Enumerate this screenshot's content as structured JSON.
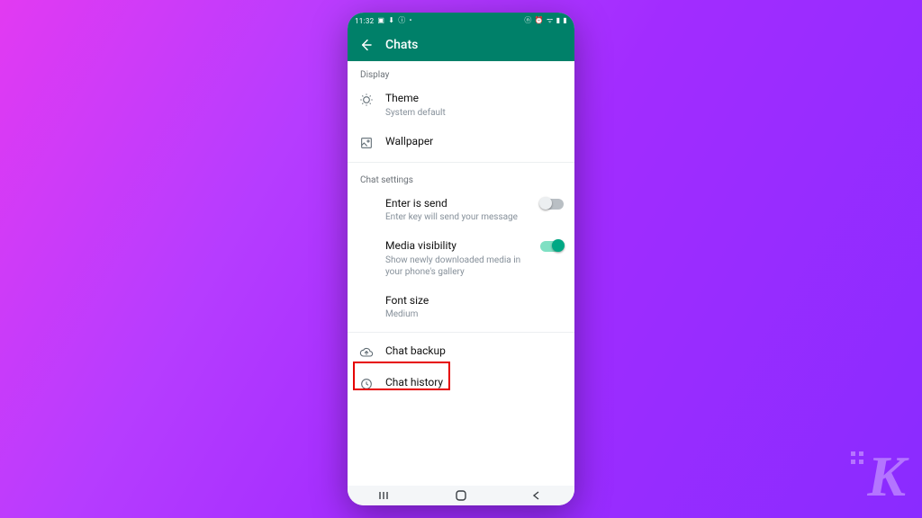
{
  "statusbar": {
    "time": "11:32"
  },
  "appbar": {
    "title": "Chats"
  },
  "sections": {
    "display": {
      "header": "Display",
      "theme": {
        "title": "Theme",
        "sub": "System default"
      },
      "wallpaper": {
        "title": "Wallpaper"
      }
    },
    "chat_settings": {
      "header": "Chat settings",
      "enter_is_send": {
        "title": "Enter is send",
        "sub": "Enter key will send your message",
        "enabled": false
      },
      "media_visibility": {
        "title": "Media visibility",
        "sub": "Show newly downloaded media in your phone's gallery",
        "enabled": true
      },
      "font_size": {
        "title": "Font size",
        "sub": "Medium"
      }
    },
    "other": {
      "chat_backup": {
        "title": "Chat backup"
      },
      "chat_history": {
        "title": "Chat history"
      }
    }
  }
}
